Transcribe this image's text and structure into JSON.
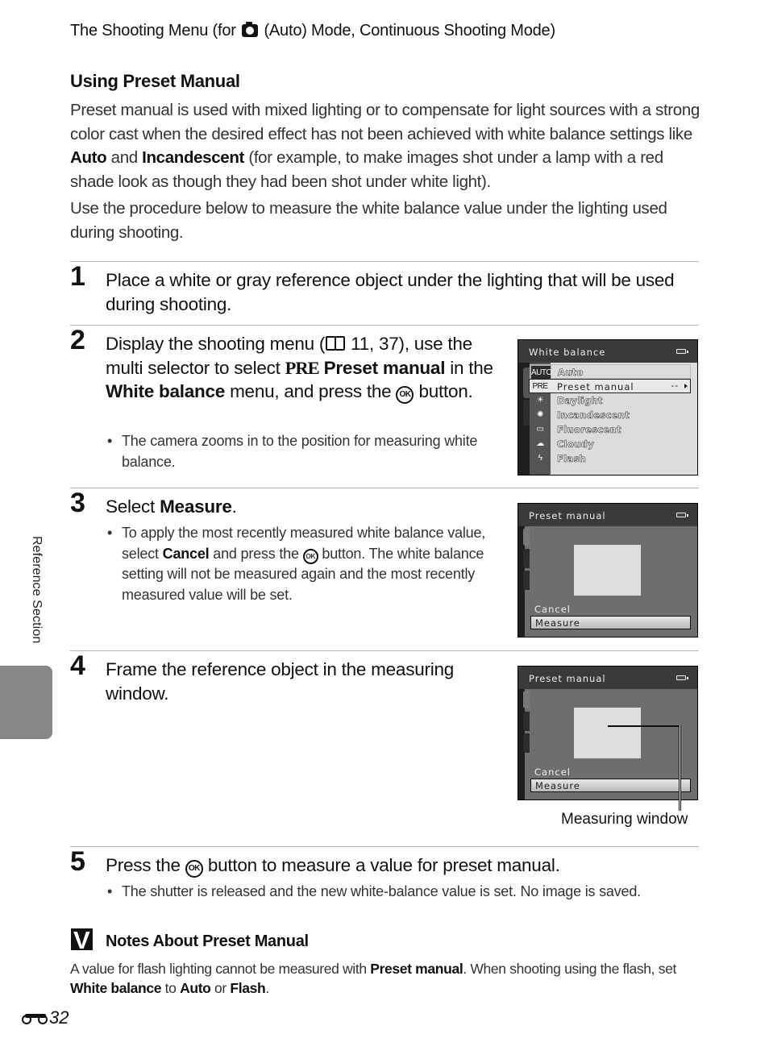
{
  "header": {
    "prefix": "The Shooting Menu (for",
    "icon": "camera-auto-icon",
    "suffix": "(Auto) Mode, Continuous Shooting Mode)"
  },
  "section": {
    "title": "Using Preset Manual",
    "intro1": {
      "a": "Preset manual is used with mixed lighting or to compensate for light sources with a strong color cast when the desired effect has not been achieved with white balance settings like",
      "b1": "Auto",
      "c": "and",
      "b2": "Incandescent",
      "d": "(for example, to make images shot under a lamp with a red shade look as though they had been shot under white light)."
    },
    "intro2": "Use the procedure below to measure the white balance value under the lighting used during shooting."
  },
  "steps": [
    {
      "number": "1",
      "text": "Place a white or gray reference object under the lighting that will be used during shooting."
    },
    {
      "number": "2",
      "text_a": "Display the shooting menu (",
      "book_icon": "book-reference-icon",
      "text_b": "11, 37), use the multi selector to select",
      "pre_glyph": "PRE",
      "bold1": "Preset manual",
      "text_c": "in the",
      "bold2": "White balance",
      "text_d": "menu, and press the",
      "ok_icon": "OK",
      "text_e": "button.",
      "bullet": "The camera zooms in to the position for measuring white balance."
    },
    {
      "number": "3",
      "text_a": "Select",
      "bold": "Measure",
      "text_b": ".",
      "bullet_a": "To apply the most recently measured white balance value, select",
      "bullet_bold": "Cancel",
      "bullet_b": "and press the",
      "bullet_ok": "OK",
      "bullet_c": "button. The white balance setting will not be measured again and the most recently measured value will be set."
    },
    {
      "number": "4",
      "text": "Frame the reference object in the measuring window.",
      "callout": "Measuring window"
    },
    {
      "number": "5",
      "text_a": "Press the",
      "ok_icon": "OK",
      "text_b": "button to measure a value for preset manual.",
      "bullet": "The shutter is released and the new white-balance value is set. No image is saved."
    }
  ],
  "screens": {
    "white_balance": {
      "title": "White balance",
      "items": [
        {
          "icon": "AUTO",
          "label": "Auto"
        },
        {
          "icon": "PRE",
          "label": "Preset manual",
          "value": "--",
          "selected": true
        },
        {
          "icon": "☀",
          "label": "Daylight"
        },
        {
          "icon": "✺",
          "label": "Incandescent"
        },
        {
          "icon": "▭",
          "label": "Fluorescent"
        },
        {
          "icon": "☁",
          "label": "Cloudy"
        },
        {
          "icon": "ϟ",
          "label": "Flash"
        }
      ]
    },
    "preset_manual": {
      "title": "Preset manual",
      "options": [
        "Cancel",
        "Measure"
      ],
      "selected": "Measure"
    }
  },
  "note": {
    "title": "Notes About Preset Manual",
    "a": "A value for flash lighting cannot be measured with",
    "b1": "Preset manual",
    "c": ". When shooting using the flash, set",
    "b2": "White balance",
    "d": "to",
    "b3": "Auto",
    "e": "or",
    "b4": "Flash",
    "f": "."
  },
  "footer": {
    "page_number": "32",
    "side_label": "Reference Section"
  }
}
